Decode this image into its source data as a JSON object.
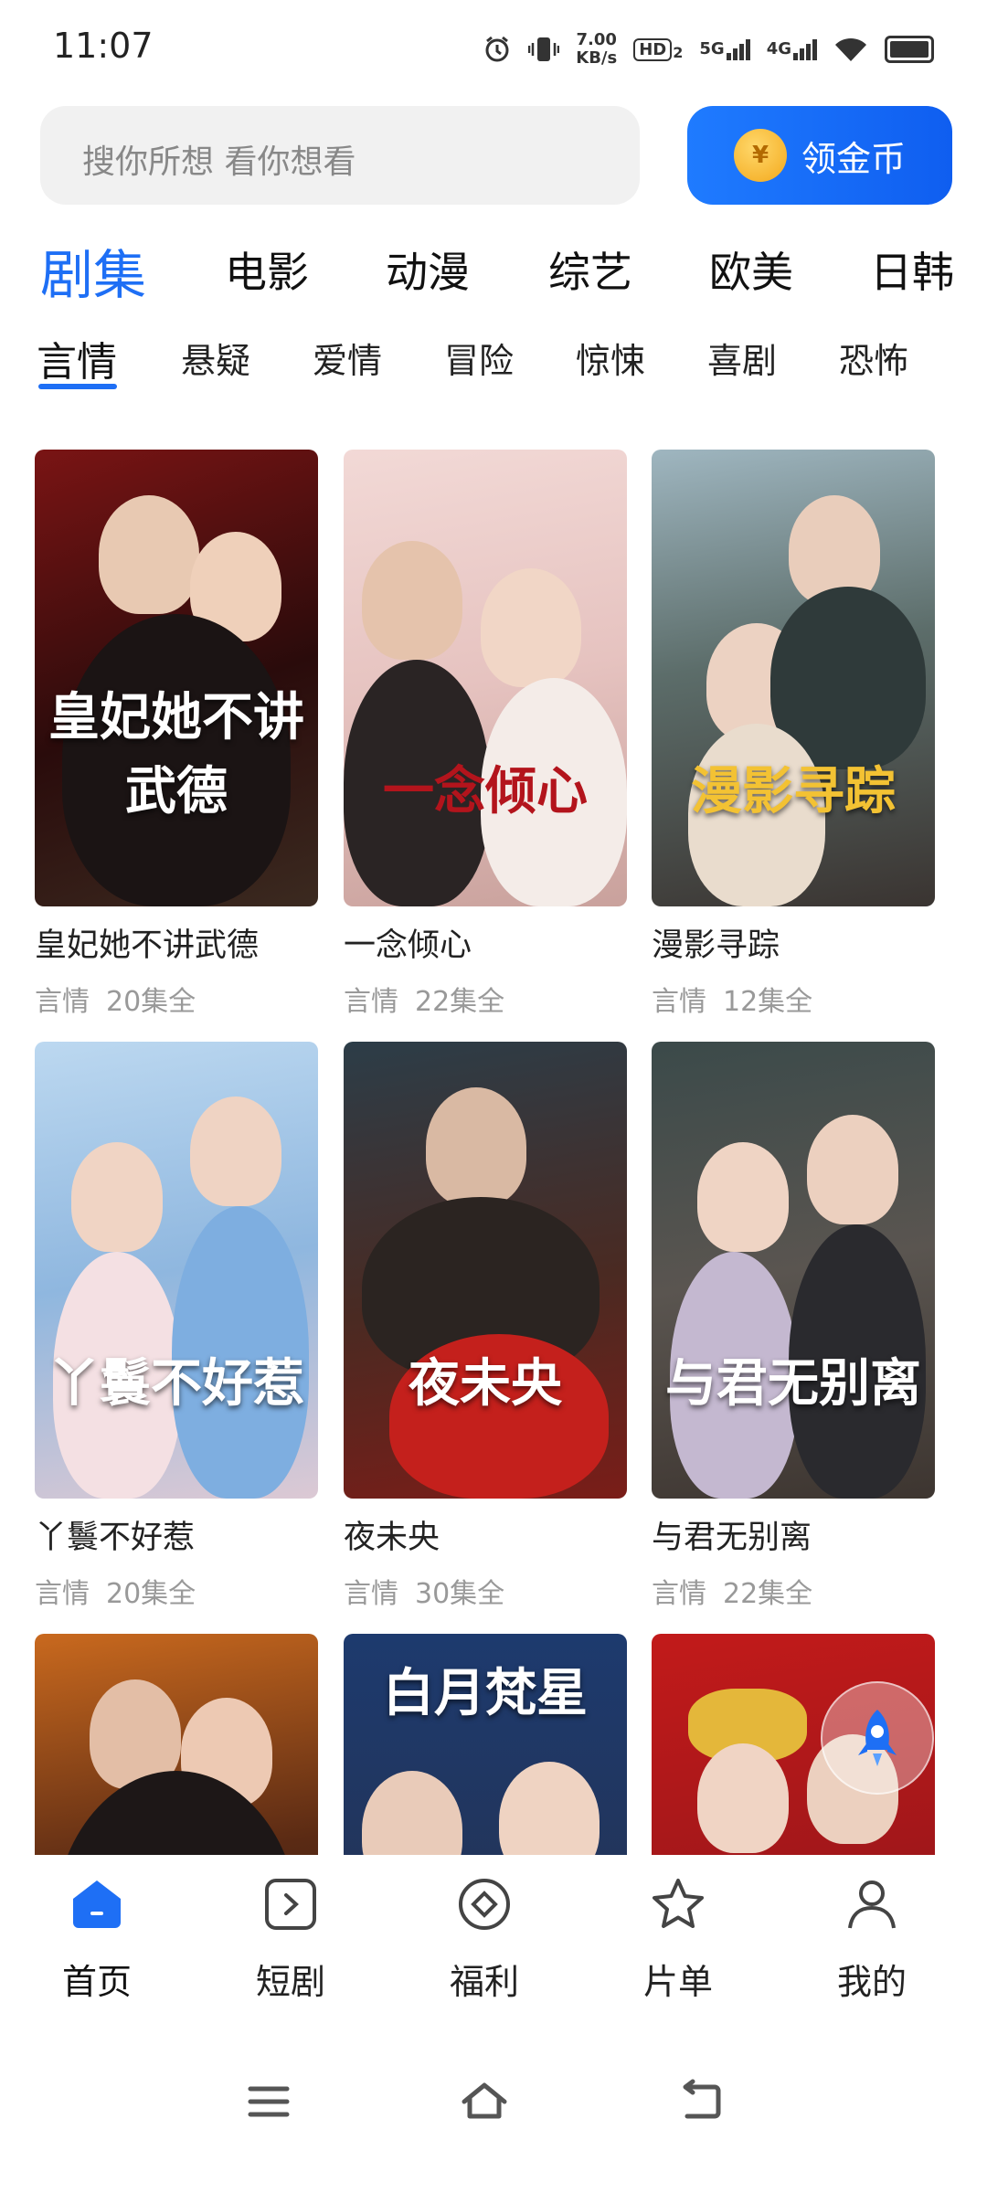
{
  "status_bar": {
    "time": "11:07",
    "net_speed_value": "7.00",
    "net_speed_unit": "KB/s",
    "hd": "HD",
    "hd_sub": "2",
    "sig1": "5G",
    "sig2": "4G"
  },
  "search": {
    "placeholder": "搜你所想 看你想看",
    "coin_symbol": "¥",
    "coin_button": "领金币"
  },
  "categories": [
    "剧集",
    "电影",
    "动漫",
    "综艺",
    "欧美",
    "日韩"
  ],
  "subcategories": [
    "言情",
    "悬疑",
    "爱情",
    "冒险",
    "惊悚",
    "喜剧",
    "恐怖"
  ],
  "cards": [
    {
      "title": "皇妃她不讲武德",
      "genre": "言情",
      "episodes": "20集全",
      "poster_text": "皇妃她不讲武德"
    },
    {
      "title": "一念倾心",
      "genre": "言情",
      "episodes": "22集全",
      "poster_text": "一念倾心"
    },
    {
      "title": "漫影寻踪",
      "genre": "言情",
      "episodes": "12集全",
      "poster_text": "漫影寻踪"
    },
    {
      "title": "丫鬟不好惹",
      "genre": "言情",
      "episodes": "20集全",
      "poster_text": "丫鬟不好惹"
    },
    {
      "title": "夜未央",
      "genre": "言情",
      "episodes": "30集全",
      "poster_text": "夜未央"
    },
    {
      "title": "与君无别离",
      "genre": "言情",
      "episodes": "22集全",
      "poster_text": "与君无别离"
    },
    {
      "poster_text": ""
    },
    {
      "poster_text": "白月梵星"
    },
    {
      "poster_text": ""
    }
  ],
  "bottom_nav": [
    "首页",
    "短剧",
    "福利",
    "片单",
    "我的"
  ],
  "colors": {
    "accent": "#1e6ff5",
    "coin_button": "#1f7bff"
  }
}
